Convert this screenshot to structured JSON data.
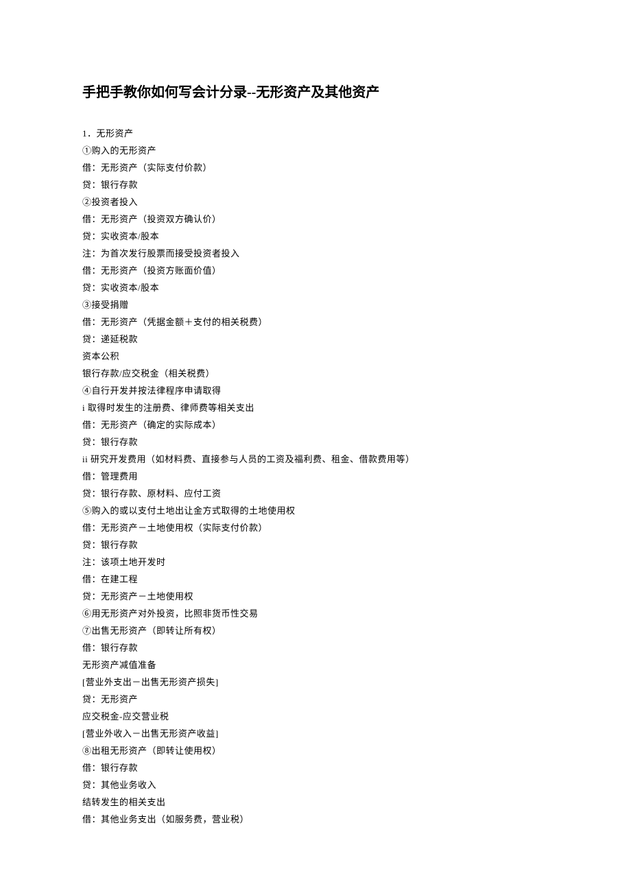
{
  "title": "手把手教你如何写会计分录--无形资产及其他资产",
  "lines": [
    "1．无形资产",
    "①购入的无形资产",
    "借：无形资产（实际支付价款）",
    "贷：银行存款",
    "②投资者投入",
    "借：无形资产（投资双方确认价）",
    "贷：实收资本/股本",
    "注：为首次发行股票而接受投资者投入",
    "借：无形资产（投资方账面价值）",
    "贷：实收资本/股本",
    "③接受捐赠",
    "借：无形资产（凭据金额＋支付的相关税费）",
    "贷：递延税款",
    "资本公积",
    "银行存款/应交税金（相关税费）",
    "④自行开发并按法律程序申请取得",
    "i 取得时发生的注册费、律师费等相关支出",
    "借：无形资产（确定的实际成本）",
    "贷：银行存款",
    "ii 研究开发费用（如材料费、直接参与人员的工资及福利费、租金、借款费用等）",
    "借：管理费用",
    "贷：银行存款、原材料、应付工资",
    "⑤购入的或以支付土地出让金方式取得的土地使用权",
    "借：无形资产－土地使用权（实际支付价款）",
    "贷：银行存款",
    "注：该项土地开发时",
    "借：在建工程",
    "贷：无形资产－土地使用权",
    "⑥用无形资产对外投资，比照非货币性交易",
    "⑦出售无形资产（即转让所有权）",
    "借：银行存款",
    "无形资产减值准备",
    "[营业外支出－出售无形资产损失]",
    "贷：无形资产",
    "应交税金-应交营业税",
    "[营业外收入－出售无形资产收益]",
    "⑧出租无形资产（即转让使用权）",
    "借：银行存款",
    "贷：其他业务收入",
    "结转发生的相关支出",
    "借：其他业务支出（如服务费，营业税）"
  ]
}
